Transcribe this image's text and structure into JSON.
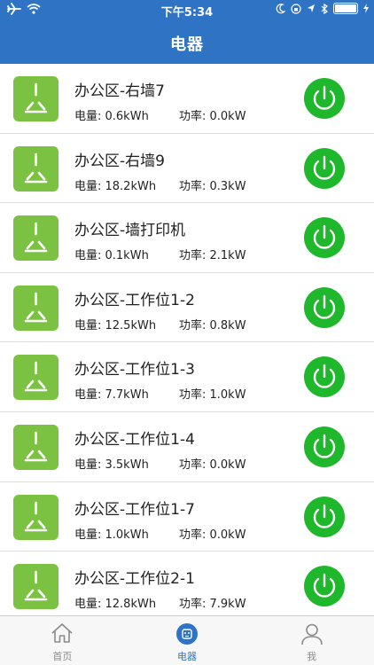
{
  "statusbar": {
    "time": "下午5:34"
  },
  "header": {
    "title": "电器"
  },
  "devices": [
    {
      "name": "办公区-右墙7",
      "energy": "电量: 0.6kWh",
      "power": "功率: 0.0kW"
    },
    {
      "name": "办公区-右墙9",
      "energy": "电量: 18.2kWh",
      "power": "功率: 0.3kW"
    },
    {
      "name": "办公区-墙打印机",
      "energy": "电量: 0.1kWh",
      "power": "功率: 2.1kW"
    },
    {
      "name": "办公区-工作位1-2",
      "energy": "电量: 12.5kWh",
      "power": "功率: 0.8kW"
    },
    {
      "name": "办公区-工作位1-3",
      "energy": "电量: 7.7kWh",
      "power": "功率: 1.0kW"
    },
    {
      "name": "办公区-工作位1-4",
      "energy": "电量: 3.5kWh",
      "power": "功率: 0.0kW"
    },
    {
      "name": "办公区-工作位1-7",
      "energy": "电量: 1.0kWh",
      "power": "功率: 0.0kW"
    },
    {
      "name": "办公区-工作位2-1",
      "energy": "电量: 12.8kWh",
      "power": "功率: 7.9kW"
    }
  ],
  "tabbar": {
    "items": [
      {
        "label": "首页",
        "icon": "home-icon"
      },
      {
        "label": "电器",
        "icon": "outlet-icon"
      },
      {
        "label": "我",
        "icon": "user-icon"
      }
    ],
    "active_index": 1
  },
  "colors": {
    "header": "#2f74c4",
    "plug_tile": "#7cc242",
    "power_button": "#1fb72b",
    "tab_active": "#2f74c4"
  }
}
